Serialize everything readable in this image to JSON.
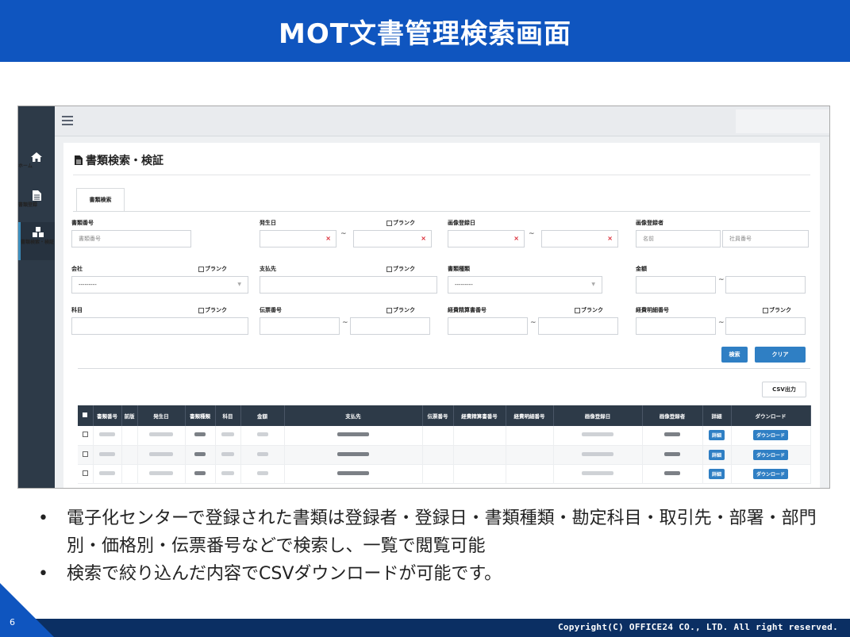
{
  "slide": {
    "title": "MOT文書管理検索画面",
    "page_number": "6",
    "copyright": "Copyright(C) OFFICE24 CO., LTD. All right reserved.",
    "bullets": [
      "電子化センターで登録された書類は登録者・登録日・書類種類・勘定科目・取引先・部署・部門別・価格別・伝票番号などで検索し、一覧で閲覧可能",
      "検索で絞り込んだ内容でCSVダウンロードが可能です。"
    ],
    "bullet_marker": "•"
  },
  "sidebar": {
    "items": [
      {
        "label": "ホーム",
        "icon": "home-icon"
      },
      {
        "label": "書類登録",
        "icon": "document-icon"
      },
      {
        "label": "書類検索・検証",
        "icon": "cubes-icon"
      }
    ]
  },
  "page": {
    "title": "書類検索・検証",
    "tab": "書類検索",
    "blank_label": "ブランク",
    "tilde": "~"
  },
  "form": {
    "doc_number": {
      "label": "書類番号",
      "placeholder": "書類番号"
    },
    "issue_date": {
      "label": "発生日"
    },
    "image_reg_date": {
      "label": "画像登録日"
    },
    "image_registrant": {
      "label": "画像登録者",
      "name_placeholder": "名前",
      "emp_placeholder": "社員番号"
    },
    "company": {
      "label": "会社",
      "value": "---------"
    },
    "payee": {
      "label": "支払先"
    },
    "doc_type": {
      "label": "書類種類",
      "value": "---------"
    },
    "amount": {
      "label": "金額"
    },
    "account": {
      "label": "科目"
    },
    "slip_number": {
      "label": "伝票番号"
    },
    "expense_sheet": {
      "label": "経費精算書番号"
    },
    "expense_detail": {
      "label": "経費明細番号"
    }
  },
  "buttons": {
    "search": "検索",
    "clear": "クリア",
    "csv": "CSV出力"
  },
  "table": {
    "columns": [
      "書類番号",
      "前版",
      "発生日",
      "書類種類",
      "科目",
      "金額",
      "支払先",
      "伝票番号",
      "経費精算書番号",
      "経費明細番号",
      "画像登録日",
      "画像登録者",
      "詳細",
      "ダウンロード"
    ],
    "row_detail": "詳細",
    "row_download": "ダウンロード",
    "row_count": 3
  }
}
